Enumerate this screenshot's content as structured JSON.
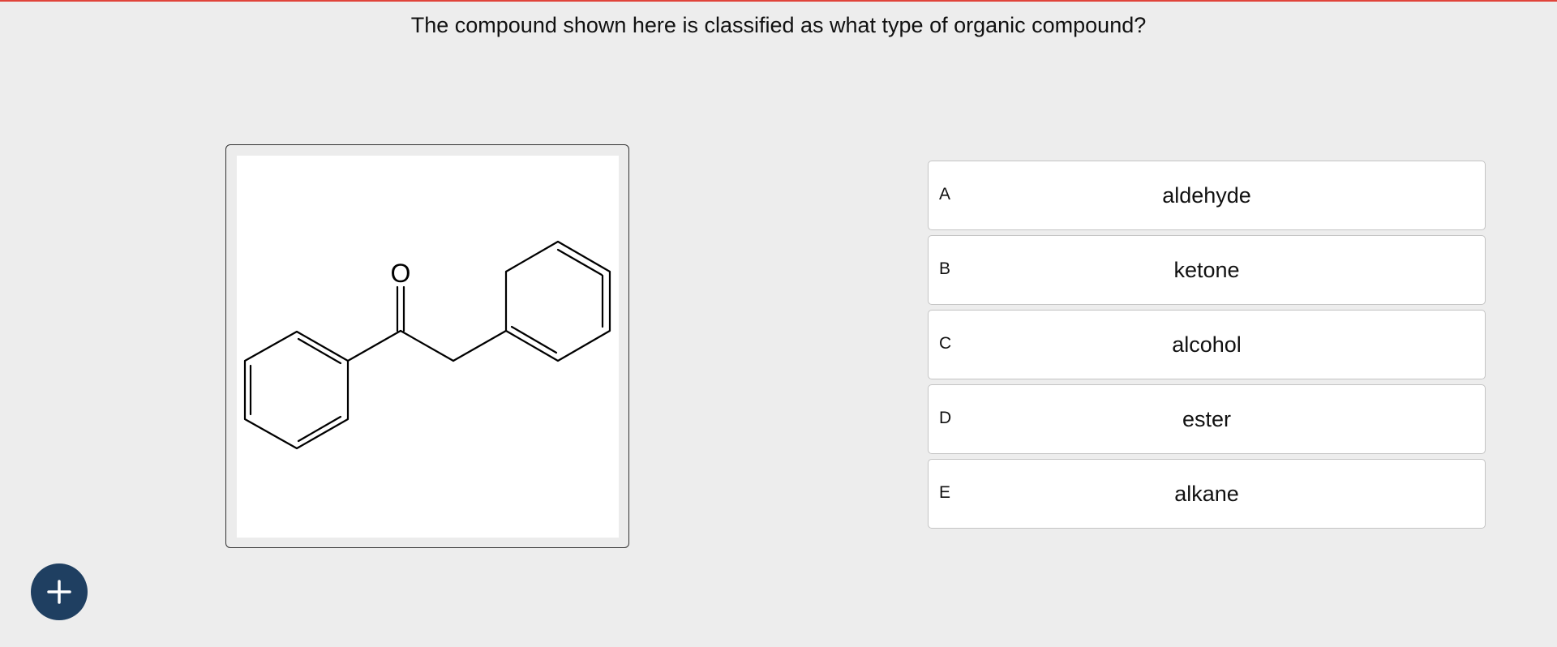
{
  "question": {
    "text": "The compound shown here is classified as what type of organic compound?"
  },
  "figure": {
    "oxygen_label": "O"
  },
  "choices": [
    {
      "letter": "A",
      "text": "aldehyde"
    },
    {
      "letter": "B",
      "text": "ketone"
    },
    {
      "letter": "C",
      "text": "alcohol"
    },
    {
      "letter": "D",
      "text": "ester"
    },
    {
      "letter": "E",
      "text": "alkane"
    }
  ],
  "fab": {
    "icon": "plus-icon"
  },
  "colors": {
    "top_accent": "#e0443a",
    "fab_background": "#1f3f61",
    "page_background": "#ededed"
  }
}
